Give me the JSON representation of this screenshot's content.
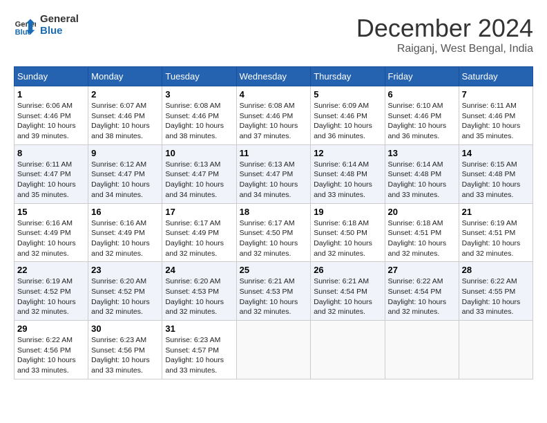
{
  "header": {
    "logo_line1": "General",
    "logo_line2": "Blue",
    "month": "December 2024",
    "location": "Raiganj, West Bengal, India"
  },
  "weekdays": [
    "Sunday",
    "Monday",
    "Tuesday",
    "Wednesday",
    "Thursday",
    "Friday",
    "Saturday"
  ],
  "weeks": [
    [
      {
        "day": "1",
        "sunrise": "6:06 AM",
        "sunset": "4:46 PM",
        "daylight": "10 hours and 39 minutes."
      },
      {
        "day": "2",
        "sunrise": "6:07 AM",
        "sunset": "4:46 PM",
        "daylight": "10 hours and 38 minutes."
      },
      {
        "day": "3",
        "sunrise": "6:08 AM",
        "sunset": "4:46 PM",
        "daylight": "10 hours and 38 minutes."
      },
      {
        "day": "4",
        "sunrise": "6:08 AM",
        "sunset": "4:46 PM",
        "daylight": "10 hours and 37 minutes."
      },
      {
        "day": "5",
        "sunrise": "6:09 AM",
        "sunset": "4:46 PM",
        "daylight": "10 hours and 36 minutes."
      },
      {
        "day": "6",
        "sunrise": "6:10 AM",
        "sunset": "4:46 PM",
        "daylight": "10 hours and 36 minutes."
      },
      {
        "day": "7",
        "sunrise": "6:11 AM",
        "sunset": "4:46 PM",
        "daylight": "10 hours and 35 minutes."
      }
    ],
    [
      {
        "day": "8",
        "sunrise": "6:11 AM",
        "sunset": "4:47 PM",
        "daylight": "10 hours and 35 minutes."
      },
      {
        "day": "9",
        "sunrise": "6:12 AM",
        "sunset": "4:47 PM",
        "daylight": "10 hours and 34 minutes."
      },
      {
        "day": "10",
        "sunrise": "6:13 AM",
        "sunset": "4:47 PM",
        "daylight": "10 hours and 34 minutes."
      },
      {
        "day": "11",
        "sunrise": "6:13 AM",
        "sunset": "4:47 PM",
        "daylight": "10 hours and 34 minutes."
      },
      {
        "day": "12",
        "sunrise": "6:14 AM",
        "sunset": "4:48 PM",
        "daylight": "10 hours and 33 minutes."
      },
      {
        "day": "13",
        "sunrise": "6:14 AM",
        "sunset": "4:48 PM",
        "daylight": "10 hours and 33 minutes."
      },
      {
        "day": "14",
        "sunrise": "6:15 AM",
        "sunset": "4:48 PM",
        "daylight": "10 hours and 33 minutes."
      }
    ],
    [
      {
        "day": "15",
        "sunrise": "6:16 AM",
        "sunset": "4:49 PM",
        "daylight": "10 hours and 32 minutes."
      },
      {
        "day": "16",
        "sunrise": "6:16 AM",
        "sunset": "4:49 PM",
        "daylight": "10 hours and 32 minutes."
      },
      {
        "day": "17",
        "sunrise": "6:17 AM",
        "sunset": "4:49 PM",
        "daylight": "10 hours and 32 minutes."
      },
      {
        "day": "18",
        "sunrise": "6:17 AM",
        "sunset": "4:50 PM",
        "daylight": "10 hours and 32 minutes."
      },
      {
        "day": "19",
        "sunrise": "6:18 AM",
        "sunset": "4:50 PM",
        "daylight": "10 hours and 32 minutes."
      },
      {
        "day": "20",
        "sunrise": "6:18 AM",
        "sunset": "4:51 PM",
        "daylight": "10 hours and 32 minutes."
      },
      {
        "day": "21",
        "sunrise": "6:19 AM",
        "sunset": "4:51 PM",
        "daylight": "10 hours and 32 minutes."
      }
    ],
    [
      {
        "day": "22",
        "sunrise": "6:19 AM",
        "sunset": "4:52 PM",
        "daylight": "10 hours and 32 minutes."
      },
      {
        "day": "23",
        "sunrise": "6:20 AM",
        "sunset": "4:52 PM",
        "daylight": "10 hours and 32 minutes."
      },
      {
        "day": "24",
        "sunrise": "6:20 AM",
        "sunset": "4:53 PM",
        "daylight": "10 hours and 32 minutes."
      },
      {
        "day": "25",
        "sunrise": "6:21 AM",
        "sunset": "4:53 PM",
        "daylight": "10 hours and 32 minutes."
      },
      {
        "day": "26",
        "sunrise": "6:21 AM",
        "sunset": "4:54 PM",
        "daylight": "10 hours and 32 minutes."
      },
      {
        "day": "27",
        "sunrise": "6:22 AM",
        "sunset": "4:54 PM",
        "daylight": "10 hours and 32 minutes."
      },
      {
        "day": "28",
        "sunrise": "6:22 AM",
        "sunset": "4:55 PM",
        "daylight": "10 hours and 33 minutes."
      }
    ],
    [
      {
        "day": "29",
        "sunrise": "6:22 AM",
        "sunset": "4:56 PM",
        "daylight": "10 hours and 33 minutes."
      },
      {
        "day": "30",
        "sunrise": "6:23 AM",
        "sunset": "4:56 PM",
        "daylight": "10 hours and 33 minutes."
      },
      {
        "day": "31",
        "sunrise": "6:23 AM",
        "sunset": "4:57 PM",
        "daylight": "10 hours and 33 minutes."
      },
      null,
      null,
      null,
      null
    ]
  ]
}
